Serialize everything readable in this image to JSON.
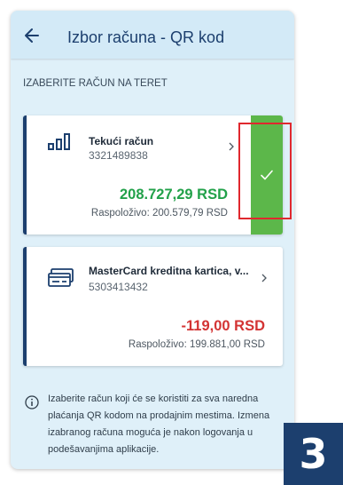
{
  "header": {
    "title": "Izbor računa - QR kod"
  },
  "section_label": "IZABERITE RAČUN NA TERET",
  "accounts": [
    {
      "icon": "bar-chart-icon",
      "name": "Tekući račun",
      "number": "3321489838",
      "amount": "208.727,29 RSD",
      "available": "Raspoloživo: 200.579,79 RSD",
      "selected": true
    },
    {
      "icon": "credit-card-icon",
      "name": "MasterCard kreditna kartica, v...",
      "number": "5303413432",
      "amount": "-119,00 RSD",
      "available": "Raspoloživo: 199.881,00 RSD",
      "selected": false
    }
  ],
  "info": {
    "icon": "info-icon",
    "text": "Izaberite račun koji će se koristiti za sva naredna plaćanja QR kodom na prodajnim mestima. Izmena izabranog računa moguća je nakon logovanja u podešavanjima aplikacije."
  },
  "step_badge": "3",
  "colors": {
    "primary": "#1c3f6e",
    "positive": "#22a14a",
    "negative": "#d33333",
    "selected": "#5cb74a",
    "highlight": "#e0282e"
  }
}
